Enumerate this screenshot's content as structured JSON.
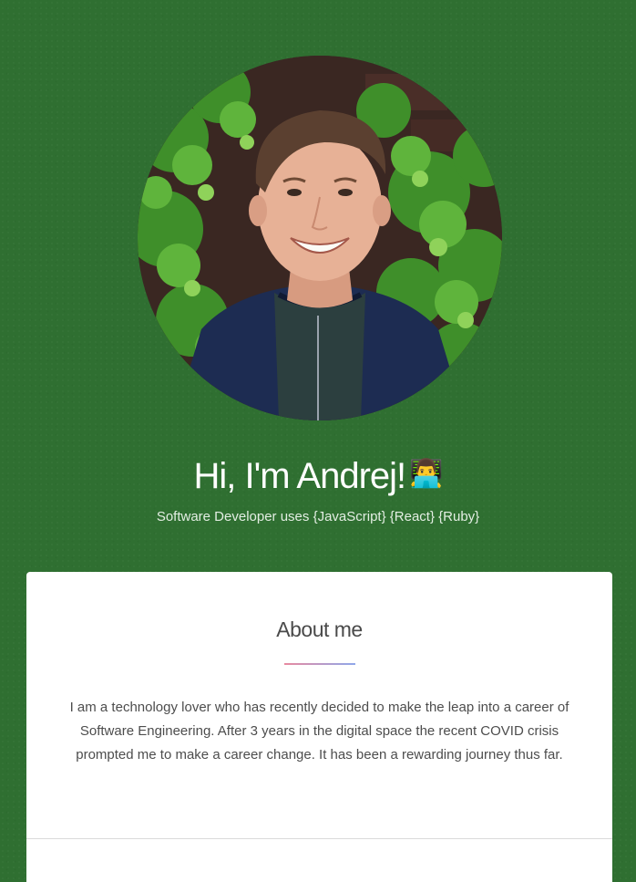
{
  "hero": {
    "greeting": "Hi, I'm Andrej!",
    "emoji": "👨‍💻",
    "tagline": "Software Developer uses {JavaScript} {React} {Ruby}"
  },
  "about": {
    "title": "About me",
    "body": "I am a technology lover who has recently decided to make the leap into a career of Software Engineering. After 3 years in the digital space the recent COVID crisis prompted me to make a career change. It has been a rewarding journey thus far."
  },
  "colors": {
    "background": "#2f6f31",
    "card": "#ffffff",
    "divider_start": "#e88aa0",
    "divider_end": "#8fa8ea"
  }
}
